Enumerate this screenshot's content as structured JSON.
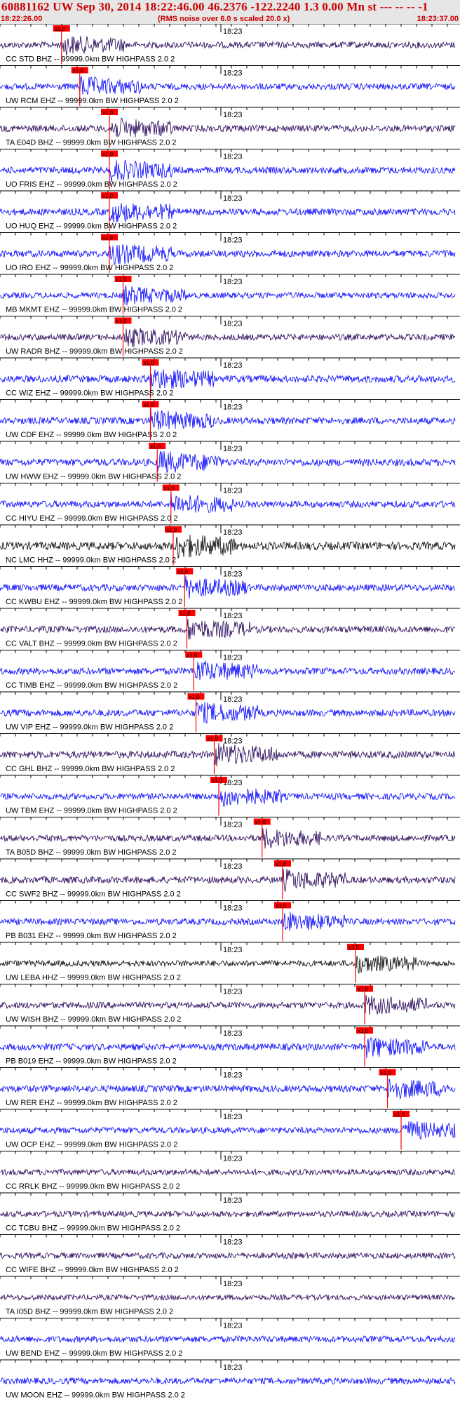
{
  "header": {
    "title": "60881162 UW Sep 30, 2014 18:22:46.00   46.2376 -122.2240  1.3 0.00 Mn st --- -- --  -1",
    "start_time": "18:22:26.00",
    "scale_note": "(RMS noise over 6.0 s scaled 20.0 x)",
    "end_time": "18:23:37.00"
  },
  "minute_label": "18:23",
  "pick_label": "x1.0",
  "colors": {
    "blue": "#0000ff",
    "dark": "#220055",
    "black": "#000000",
    "pick": "#ff0000",
    "axis": "#000000"
  },
  "traces": [
    {
      "label": "CC STD BHZ -- 99999.0km BW  HIGHPASS  2.0  2",
      "color": "dark",
      "pick": 0.135,
      "level": 0.25
    },
    {
      "label": "UW RCM EHZ -- 99999.0km BW  HIGHPASS  2.0  2",
      "color": "blue",
      "pick": 0.175,
      "level": 0.25
    },
    {
      "label": "TA E04D BHZ -- 99999.0km BW  HIGHPASS  2.0  2",
      "color": "dark",
      "pick": 0.24,
      "level": 0.3
    },
    {
      "label": "UO FRIS EHZ -- 99999.0km BW  HIGHPASS  2.0  2",
      "color": "blue",
      "pick": 0.24,
      "level": 0.3
    },
    {
      "label": "UO HUQ EHZ -- 99999.0km BW  HIGHPASS  2.0  2",
      "color": "blue",
      "pick": 0.24,
      "level": 0.3
    },
    {
      "label": "UO IRO EHZ -- 99999.0km BW  HIGHPASS  2.0  2",
      "color": "blue",
      "pick": 0.24,
      "level": 0.3
    },
    {
      "label": "MB MKMT EHZ -- 99999.0km BW  HIGHPASS  2.0  2",
      "color": "blue",
      "pick": 0.27,
      "level": 0.2
    },
    {
      "label": "UW RADR BHZ -- 99999.0km BW  HIGHPASS  2.0  2",
      "color": "dark",
      "pick": 0.27,
      "level": 0.25
    },
    {
      "label": "CC WIZ EHZ -- 99999.0km BW  HIGHPASS  2.0  2",
      "color": "blue",
      "pick": 0.33,
      "level": 0.35
    },
    {
      "label": "UW CDF EHZ -- 99999.0km BW  HIGHPASS  2.0  2",
      "color": "blue",
      "pick": 0.33,
      "level": 0.3
    },
    {
      "label": "UW HWW EHZ -- 99999.0km BW  HIGHPASS  2.0  2",
      "color": "blue",
      "pick": 0.345,
      "level": 0.35
    },
    {
      "label": "CC HIYU EHZ -- 99999.0km BW  HIGHPASS  2.0  2",
      "color": "blue",
      "pick": 0.375,
      "level": 0.3
    },
    {
      "label": "NC LMC HHZ -- 99999.0km BW  HIGHPASS  2.0  2",
      "color": "black",
      "pick": 0.38,
      "level": 0.45
    },
    {
      "label": "CC KWBU EHZ -- 99999.0km BW  HIGHPASS  2.0  2",
      "color": "blue",
      "pick": 0.405,
      "level": 0.3
    },
    {
      "label": "CC VALT BHZ -- 99999.0km BW  HIGHPASS  2.0  2",
      "color": "dark",
      "pick": 0.41,
      "level": 0.3
    },
    {
      "label": "CC TIMB EHZ -- 99999.0km BW  HIGHPASS  2.0  2",
      "color": "blue",
      "pick": 0.425,
      "level": 0.3
    },
    {
      "label": "UW VIP EHZ -- 99999.0km BW  HIGHPASS  2.0  2",
      "color": "blue",
      "pick": 0.43,
      "level": 0.3
    },
    {
      "label": "CC GHL BHZ -- 99999.0km BW  HIGHPASS  2.0  2",
      "color": "dark",
      "pick": 0.47,
      "level": 0.35
    },
    {
      "label": "UW TBM EHZ -- 99999.0km BW  HIGHPASS  2.0  2",
      "color": "blue",
      "pick": 0.48,
      "level": 0.25
    },
    {
      "label": "TA B05D BHZ -- 99999.0km BW  HIGHPASS  2.0  2",
      "color": "dark",
      "pick": 0.575,
      "level": 0.25
    },
    {
      "label": "CC SWF2 BHZ -- 99999.0km BW  HIGHPASS  2.0  2",
      "color": "dark",
      "pick": 0.62,
      "level": 0.3
    },
    {
      "label": "PB B031 EHZ -- 99999.0km BW  HIGHPASS  2.0  2",
      "color": "blue",
      "pick": 0.62,
      "level": 0.25
    },
    {
      "label": "UW LEBA HHZ -- 99999.0km BW  HIGHPASS  2.0  2",
      "color": "black",
      "pick": 0.78,
      "level": 0.2
    },
    {
      "label": "UW WISH BHZ -- 99999.0km BW  HIGHPASS  2.0  2",
      "color": "dark",
      "pick": 0.8,
      "level": 0.25
    },
    {
      "label": "PB B019 EHZ -- 99999.0km BW  HIGHPASS  2.0  2",
      "color": "blue",
      "pick": 0.8,
      "level": 0.3
    },
    {
      "label": "UW RER EHZ -- 99999.0km BW  HIGHPASS  2.0  2",
      "color": "blue",
      "pick": 0.85,
      "level": 0.3
    },
    {
      "label": "UW OCP EHZ -- 99999.0km BW  HIGHPASS  2.0  2",
      "color": "blue",
      "pick": 0.88,
      "level": 0.25
    },
    {
      "label": "CC RRLK BHZ -- 99999.0km BW  HIGHPASS  2.0  2",
      "color": "dark",
      "pick": null,
      "level": 0.2
    },
    {
      "label": "CC TCBU BHZ -- 99999.0km BW  HIGHPASS  2.0  2",
      "color": "dark",
      "pick": null,
      "level": 0.2
    },
    {
      "label": "CC WIFE BHZ -- 99999.0km BW  HIGHPASS  2.0  2",
      "color": "dark",
      "pick": null,
      "level": 0.2
    },
    {
      "label": "TA I05D BHZ -- 99999.0km BW  HIGHPASS  2.0  2",
      "color": "dark",
      "pick": null,
      "level": 0.15
    },
    {
      "label": "UW BEND EHZ -- 99999.0km BW  HIGHPASS  2.0  2",
      "color": "blue",
      "pick": null,
      "level": 0.25
    },
    {
      "label": "UW MOON EHZ -- 99999.0km BW  HIGHPASS  2.0  2",
      "color": "blue",
      "pick": null,
      "level": 0.25
    }
  ]
}
